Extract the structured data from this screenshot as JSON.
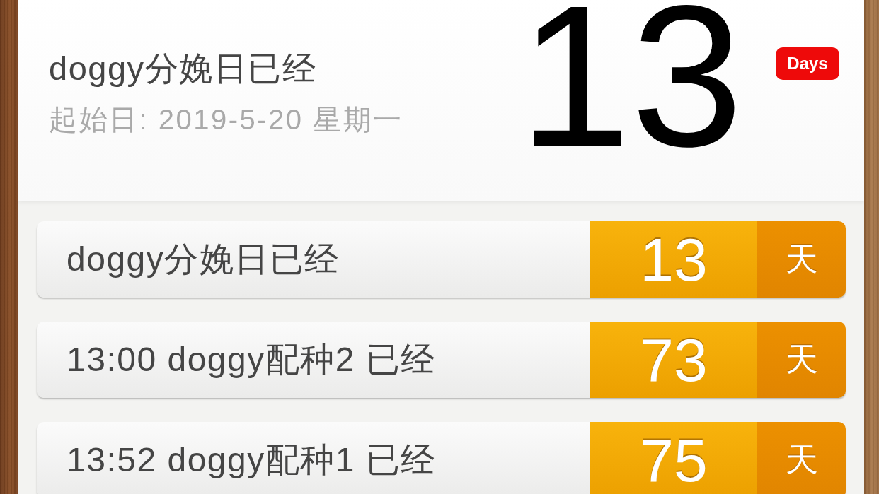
{
  "header": {
    "title": "doggy分娩日已经",
    "start_date": "起始日: 2019-5-20 星期一",
    "count": "13",
    "badge": "Days"
  },
  "events": [
    {
      "title": "doggy分娩日已经",
      "count": "13",
      "unit": "天"
    },
    {
      "title": "13:00 doggy配种2 已经",
      "count": "73",
      "unit": "天"
    },
    {
      "title": "13:52 doggy配种1 已经",
      "count": "75",
      "unit": "天"
    }
  ]
}
